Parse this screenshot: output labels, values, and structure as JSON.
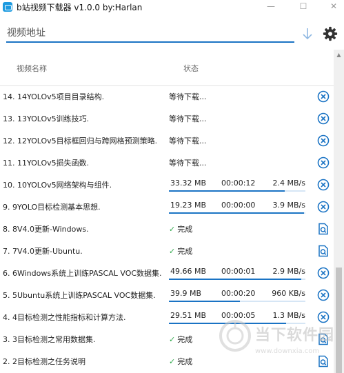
{
  "window": {
    "title": "b站视频下载器 v1.0.0 by:Harlan",
    "minimize_glyph": "—",
    "maximize_glyph": "☐",
    "close_glyph": "✕"
  },
  "toolbar": {
    "url_placeholder": "视频地址",
    "download_icon": "download-arrow-icon",
    "settings_icon": "gear-icon"
  },
  "list": {
    "headers": {
      "name": "视频名称",
      "status": "状态"
    },
    "items": [
      {
        "name": "14. 14YOLOv5项目目录结构.",
        "state": "waiting",
        "status": "等待下载..."
      },
      {
        "name": "13. 13YOLOv5训练技巧.",
        "state": "waiting",
        "status": "等待下载..."
      },
      {
        "name": "12. 12YOLOv5目标框回归与跨网格预测策略.",
        "state": "waiting",
        "status": "等待下载..."
      },
      {
        "name": "11. 11YOLOv5损失函数.",
        "state": "waiting",
        "status": "等待下载..."
      },
      {
        "name": "10. 10YOLOv5网络架构与组件.",
        "state": "downloading",
        "size": "33.32 MB",
        "time": "00:00:12",
        "speed": "2.4 MB/s",
        "progress": 0.85
      },
      {
        "name": "9. 9YOLO目标检测基本思想.",
        "state": "downloading",
        "size": "19.23 MB",
        "time": "00:00:00",
        "speed": "3.9 MB/s",
        "progress": 0.99
      },
      {
        "name": "8. 8V4.0更新-Windows.",
        "state": "done",
        "status": "完成"
      },
      {
        "name": "7. 7V4.0更新-Ubuntu.",
        "state": "done",
        "status": "完成"
      },
      {
        "name": "6. 6Windows系统上训练PASCAL VOC数据集.",
        "state": "downloading",
        "size": "49.66 MB",
        "time": "00:00:01",
        "speed": "2.9 MB/s",
        "progress": 0.97
      },
      {
        "name": "5. 5Ubuntu系统上训练PASCAL VOC数据集.",
        "state": "downloading",
        "size": "39.9 MB",
        "time": "00:00:20",
        "speed": "960 KB/s",
        "progress": 0.52
      },
      {
        "name": "4. 4目标检测之性能指标和计算方法.",
        "state": "downloading",
        "size": "29.51 MB",
        "time": "00:00:05",
        "speed": "1.3 MB/s",
        "progress": 0.86
      },
      {
        "name": "3. 3目标检测之常用数据集.",
        "state": "done",
        "status": "完成"
      },
      {
        "name": "2. 2目标检测之任务说明",
        "state": "done",
        "status": "完成"
      }
    ]
  },
  "watermark": {
    "text": "当下软件园",
    "url": "www.downxia.com"
  },
  "colors": {
    "accent": "#1a73c4",
    "done": "#2ea84a"
  }
}
